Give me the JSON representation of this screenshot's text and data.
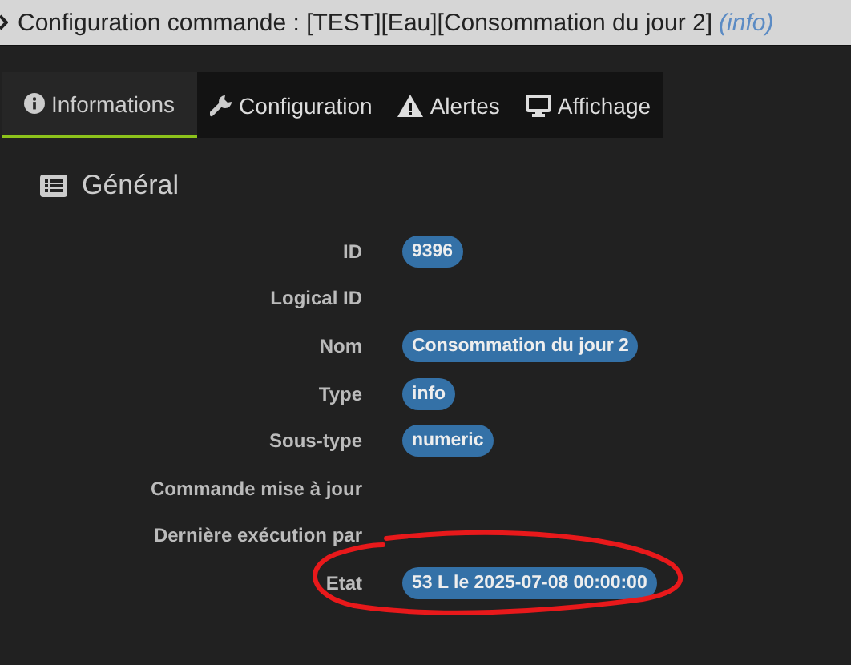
{
  "window": {
    "title": "Configuration commande : [TEST][Eau][Consommation du jour 2]",
    "subtitle": "(info)"
  },
  "tabs": [
    {
      "label": "Informations",
      "kind": "info",
      "selected": true
    },
    {
      "label": "Configuration",
      "kind": "wrench",
      "selected": false
    },
    {
      "label": "Alertes",
      "kind": "warning",
      "selected": false
    },
    {
      "label": "Affichage",
      "kind": "monitor",
      "selected": false
    }
  ],
  "section": {
    "title": "Général"
  },
  "fields": [
    {
      "label": "ID",
      "value": "9396",
      "highlighted": false
    },
    {
      "label": "Logical ID",
      "highlighted": false
    },
    {
      "label": "Nom",
      "value": "Consommation du jour 2",
      "highlighted": false
    },
    {
      "label": "Type",
      "value": "info",
      "highlighted": false
    },
    {
      "label": "Sous-type",
      "value": "numeric",
      "highlighted": false
    },
    {
      "label": "Commande mise à jour",
      "highlighted": false
    },
    {
      "label": "Dernière exécution par",
      "highlighted": false
    },
    {
      "label": "Etat",
      "value": "53 L le 2025-07-08 00:00:00",
      "highlighted": true
    }
  ]
}
